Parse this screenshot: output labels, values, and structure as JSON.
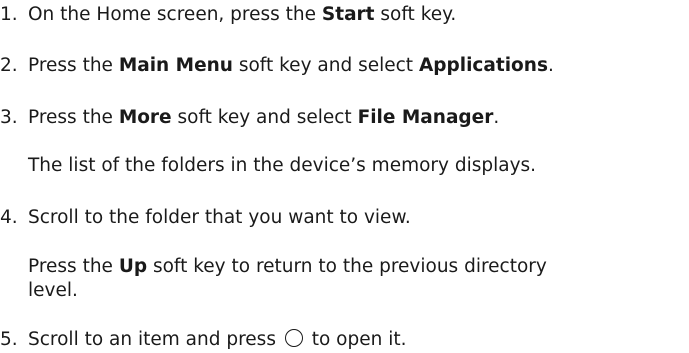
{
  "steps": [
    {
      "number": "1.",
      "parts": [
        "On the Home screen, press the ",
        "Start",
        " soft key."
      ]
    },
    {
      "number": "2.",
      "parts": [
        "Press the ",
        "Main Menu",
        " soft key and select ",
        "Applications",
        "."
      ]
    },
    {
      "number": "3.",
      "parts": [
        "Press the ",
        "More",
        " soft key and select ",
        "File Manager",
        "."
      ],
      "note": "The list of the folders in the device’s memory displays."
    },
    {
      "number": "4.",
      "parts": [
        "Scroll to the folder that you want to view."
      ],
      "note_parts": [
        "Press the ",
        "Up",
        " soft key to return to the previous directory"
      ],
      "note_continued": "level."
    },
    {
      "number": "5.",
      "parts": [
        "Scroll to an item and press ",
        " to open it."
      ],
      "icon": "circle-button-icon"
    }
  ]
}
